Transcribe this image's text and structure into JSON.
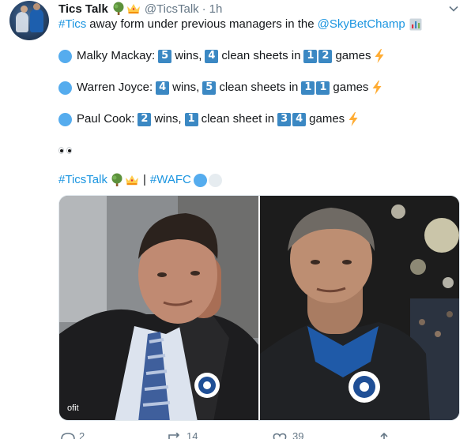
{
  "tweet": {
    "author_name": "Tics Talk",
    "author_handle": "@TicsTalk",
    "time_separator": "·",
    "timestamp": "1h",
    "text_line_1": {
      "hashtag": "#Tics",
      "text": "away form under previous managers in the",
      "mention": "@SkyBetChamp"
    },
    "managers": [
      {
        "name": "Malky Mackay:",
        "wins_value": "5",
        "wins_label": "wins,",
        "clean_sheets_value": "4",
        "clean_sheets_label": "clean sheets in",
        "games_digits": [
          "1",
          "2"
        ],
        "games_label": "games"
      },
      {
        "name": "Warren Joyce:",
        "wins_value": "4",
        "wins_label": "wins,",
        "clean_sheets_value": "5",
        "clean_sheets_label": "clean sheets in",
        "games_digits": [
          "1",
          "1"
        ],
        "games_label": "games"
      },
      {
        "name": "Paul Cook:",
        "wins_value": "2",
        "wins_label": "wins,",
        "clean_sheets_value": "1",
        "clean_sheets_label": "clean sheet in",
        "games_digits": [
          "3",
          "4"
        ],
        "games_label": "games"
      }
    ],
    "hashtags_line": {
      "hashtag_1": "#TicsTalk",
      "separator": "|",
      "hashtag_2": "#WAFC"
    },
    "media_badge_text": "WIGAN ATHLETIC",
    "action_counts": {
      "replies": "2",
      "retweets": "14",
      "likes": "39"
    }
  },
  "colors": {
    "link": "#1b95e0",
    "secondary_text": "#657786",
    "keycap": "#3b88c3",
    "blue_circle": "#55acee",
    "white_circle": "#e6ecf0",
    "lightning": "#ffac33"
  },
  "icons": {
    "badge": [
      "deciduous-tree-icon",
      "crown-icon"
    ],
    "caret": "chevron-down-icon",
    "chart": "bar-chart-icon",
    "lightning": "lightning-icon",
    "eyes": "eyes-icon"
  }
}
